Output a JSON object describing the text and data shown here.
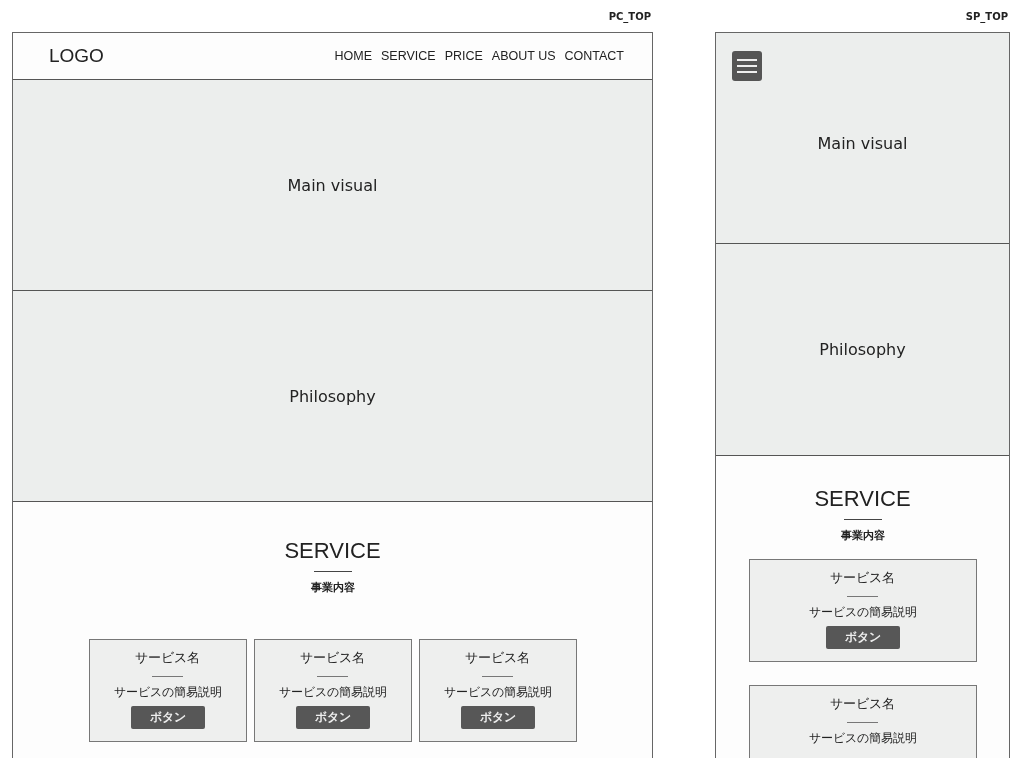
{
  "pc": {
    "label": "PC_TOP",
    "logo": "LOGO",
    "nav": [
      {
        "label": "HOME"
      },
      {
        "label": "SERVICE"
      },
      {
        "label": "PRICE"
      },
      {
        "label": "ABOUT US"
      },
      {
        "label": "CONTACT"
      }
    ],
    "main_visual": "Main visual",
    "philosophy": "Philosophy",
    "service": {
      "title": "SERVICE",
      "subtitle": "事業内容",
      "cards": [
        {
          "name": "サービス名",
          "description": "サービスの簡易説明",
          "button": "ボタン"
        },
        {
          "name": "サービス名",
          "description": "サービスの簡易説明",
          "button": "ボタン"
        },
        {
          "name": "サービス名",
          "description": "サービスの簡易説明",
          "button": "ボタン"
        }
      ]
    }
  },
  "sp": {
    "label": "SP_TOP",
    "main_visual": "Main visual",
    "philosophy": "Philosophy",
    "service": {
      "title": "SERVICE",
      "subtitle": "事業内容",
      "cards": [
        {
          "name": "サービス名",
          "description": "サービスの簡易説明",
          "button": "ボタン"
        },
        {
          "name": "サービス名",
          "description": "サービスの簡易説明"
        }
      ]
    }
  }
}
